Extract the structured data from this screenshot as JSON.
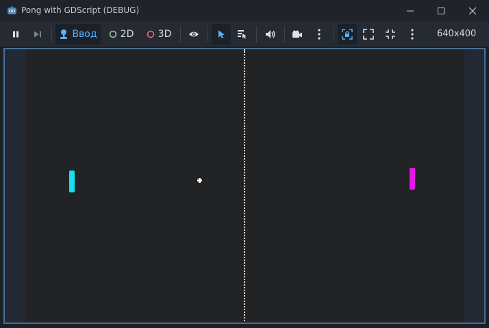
{
  "window": {
    "title": "Pong with GDScript (DEBUG)",
    "minimize_icon": "minimize-icon",
    "maximize_icon": "maximize-icon",
    "close_icon": "close-icon"
  },
  "toolbar": {
    "pause_icon": "pause-icon",
    "next_frame_icon": "next-frame-icon",
    "input_label": "Ввод",
    "mode_2d_label": "2D",
    "mode_3d_label": "3D",
    "visibility_icon": "eye-icon",
    "select_icon": "pointer-icon",
    "list_select_icon": "list-select-icon",
    "audio_icon": "speaker-icon",
    "camera_icon": "camera-icon",
    "more_icon": "kebab-menu-icon",
    "resolution": "640x400"
  },
  "colors": {
    "accent_blue": "#57b3ff",
    "left_paddle": "#16e0f2",
    "right_paddle": "#e518e8",
    "mode_2d_ring": "#8fd18f",
    "mode_3d_ring": "#e86a6a",
    "viewport_border": "#4a6e93",
    "game_background": "#222324"
  }
}
